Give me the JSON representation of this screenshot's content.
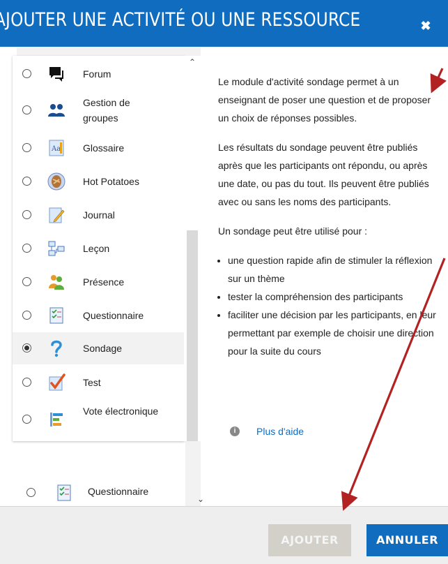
{
  "dialog": {
    "title": "AJOUTER UNE ACTIVITÉ OU UNE RESSOURCE",
    "close_icon": "close-icon"
  },
  "activities": [
    {
      "label": "Forum",
      "icon": "forum-icon"
    },
    {
      "label": "Gestion de groupes",
      "icon": "groups-icon"
    },
    {
      "label": "Glossaire",
      "icon": "glossary-icon"
    },
    {
      "label": "Hot Potatoes",
      "icon": "hot-potatoes-icon"
    },
    {
      "label": "Journal",
      "icon": "journal-icon"
    },
    {
      "label": "Leçon",
      "icon": "lesson-icon"
    },
    {
      "label": "Présence",
      "icon": "attendance-icon"
    },
    {
      "label": "Questionnaire",
      "icon": "questionnaire-icon"
    },
    {
      "label": "Sondage",
      "icon": "choice-icon",
      "selected": true
    },
    {
      "label": "Test",
      "icon": "quiz-icon"
    },
    {
      "label": "Vote électronique",
      "icon": "vote-icon"
    }
  ],
  "underlying_list": {
    "item_label": "Questionnaire"
  },
  "description": {
    "p1": "Le module d'activité sondage permet à un enseignant de poser une question et de proposer un choix de réponses possibles.",
    "p2": "Les résultats du sondage peuvent être publiés après que les participants ont répondu, ou après une date, ou pas du tout. Ils peuvent être publiés avec ou sans les noms des participants.",
    "p3": "Un sondage peut être utilisé pour :",
    "bullets": [
      "une question rapide afin de stimuler la réflexion sur un thème",
      "tester la compréhension des participants",
      "faciliter une décision par les participants, en leur permettant par exemple de choisir une direction pour la suite du cours"
    ]
  },
  "help": {
    "label": "Plus d'aide",
    "icon": "info-icon"
  },
  "footer": {
    "add_label": "AJOUTER",
    "cancel_label": "ANNULER"
  },
  "colors": {
    "header": "#0f6cbf",
    "add_disabled": "#d3cfc9",
    "annotation_arrow": "#b22222"
  }
}
